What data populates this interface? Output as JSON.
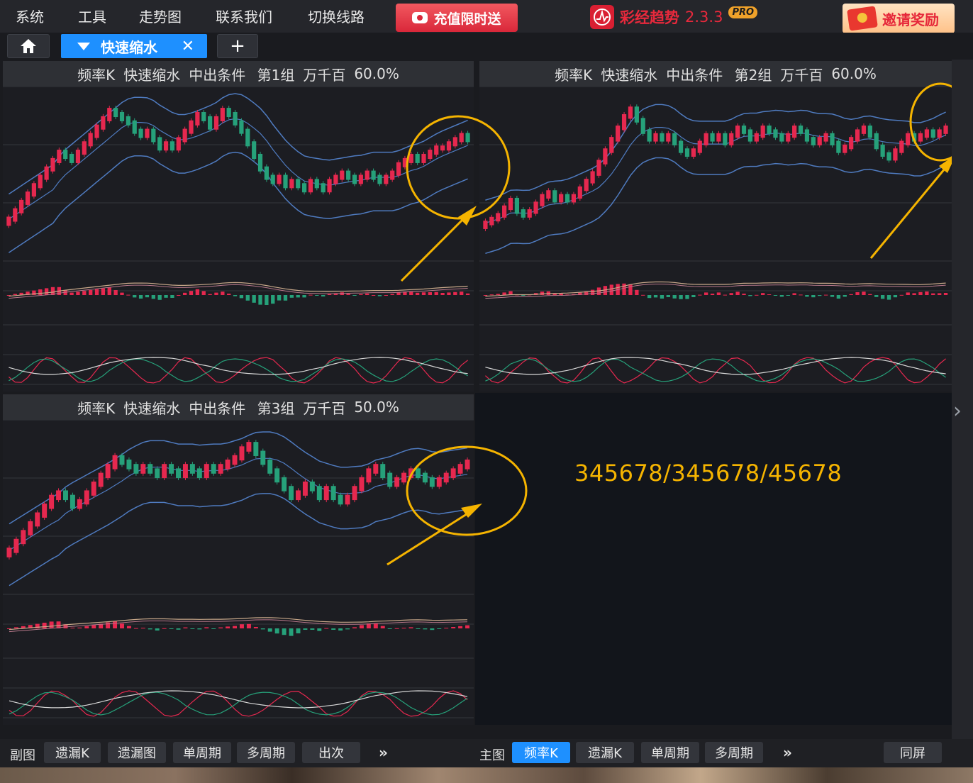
{
  "menu": {
    "items": [
      "系统",
      "工具",
      "走势图",
      "联系我们",
      "切换线路"
    ],
    "promo_label": "充值限时送",
    "brand_name": "彩经趋势",
    "brand_version": "2.3.3",
    "brand_badge": "PRO",
    "invite_label": "邀请奖励"
  },
  "tabs": {
    "active_label": "快速缩水",
    "close_symbol": "✕",
    "add_symbol": "+"
  },
  "panels": [
    {
      "header": [
        "频率K",
        "快速缩水",
        "中出条件 第1组",
        "万千百",
        "60.0%"
      ]
    },
    {
      "header": [
        "频率K",
        "快速缩水",
        "中出条件 第2组",
        "万千百",
        "60.0%"
      ]
    },
    {
      "header": [
        "频率K",
        "快速缩水",
        "中出条件 第3组",
        "万千百",
        "50.0%"
      ]
    }
  ],
  "note": "345678/345678/45678",
  "bottom": {
    "sub_label": "副图",
    "sub_buttons": [
      "遗漏K",
      "遗漏图",
      "单周期",
      "多周期",
      "出次"
    ],
    "more": "»",
    "main_label": "主图",
    "main_buttons": [
      "频率K",
      "遗漏K",
      "单周期",
      "多周期"
    ],
    "main_active": 0,
    "sync_label": "同屏"
  },
  "colors": {
    "up": "#e6284f",
    "down": "#26a17a",
    "band": "#4f7bc0",
    "annotation": "#f5b400",
    "accent": "#1e90ff"
  },
  "chart_data": [
    {
      "type": "candlestick",
      "panel": 1,
      "values": [
        10,
        12,
        14,
        16,
        18,
        20,
        22,
        24,
        26,
        25,
        24,
        26,
        28,
        30,
        32,
        34,
        36,
        35,
        34,
        33,
        31,
        30,
        31,
        29,
        27,
        28,
        27,
        29,
        31,
        33,
        35,
        34,
        32,
        34,
        36,
        35,
        33,
        31,
        28,
        25,
        22,
        20,
        19,
        20,
        18,
        19,
        18,
        17,
        19,
        18,
        17,
        19,
        20,
        21,
        20,
        19,
        20,
        21,
        20,
        19,
        20,
        21,
        23,
        24,
        25,
        24,
        25,
        26,
        27,
        27,
        28,
        29,
        30,
        29
      ]
    },
    {
      "type": "candlestick",
      "panel": 2,
      "values": [
        8,
        9,
        10,
        12,
        14,
        11,
        10,
        11,
        13,
        15,
        16,
        14,
        15,
        14,
        15,
        17,
        19,
        21,
        24,
        27,
        30,
        33,
        36,
        38,
        35,
        32,
        30,
        31,
        30,
        31,
        29,
        27,
        26,
        27,
        29,
        31,
        30,
        31,
        29,
        31,
        33,
        32,
        30,
        31,
        33,
        32,
        31,
        30,
        31,
        33,
        32,
        30,
        29,
        30,
        31,
        29,
        27,
        28,
        30,
        32,
        33,
        31,
        28,
        26,
        25,
        27,
        29,
        31,
        30,
        31,
        32,
        31,
        32,
        33
      ]
    },
    {
      "type": "candlestick",
      "panel": 3,
      "values": [
        10,
        12,
        14,
        16,
        18,
        20,
        22,
        23,
        22,
        20,
        21,
        23,
        25,
        27,
        29,
        31,
        30,
        29,
        28,
        29,
        28,
        27,
        29,
        28,
        27,
        29,
        28,
        27,
        29,
        28,
        29,
        30,
        31,
        33,
        34,
        32,
        30,
        28,
        26,
        24,
        22,
        23,
        25,
        24,
        22,
        24,
        22,
        21,
        22,
        24,
        26,
        28,
        29,
        27,
        25,
        26,
        27,
        28,
        27,
        26,
        25,
        26,
        27,
        28,
        29,
        30
      ]
    }
  ]
}
